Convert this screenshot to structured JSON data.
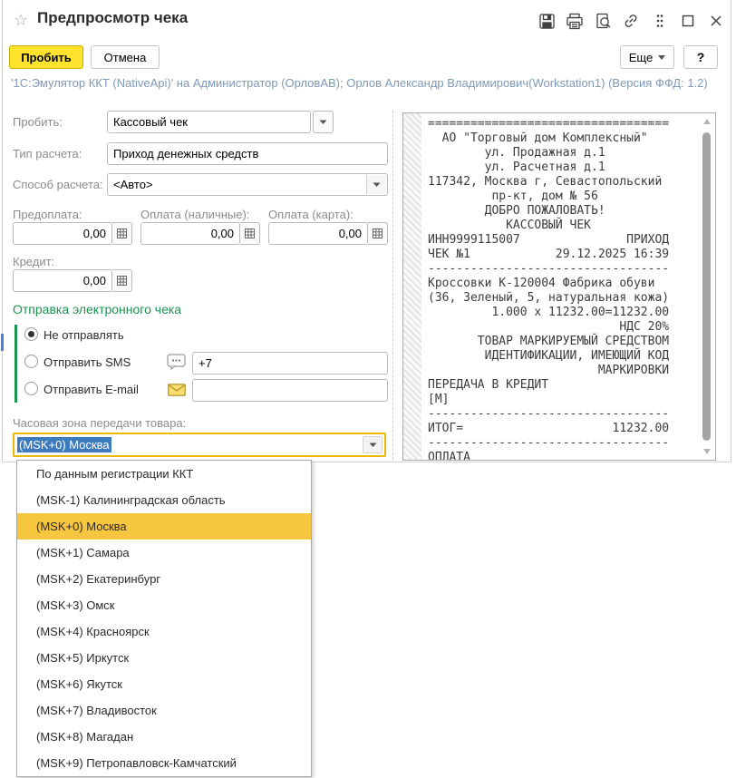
{
  "titlebar": {
    "title": "Предпросмотр чека"
  },
  "toolbar": {
    "commit_label": "Пробить",
    "cancel_label": "Отмена",
    "more_label": "Еще",
    "help_label": "?"
  },
  "device_info": "'1С:Эмулятор ККТ (NativeApi)' на Администратор (ОрловАВ); Орлов Александр Владимирович(Workstation1) (Версия ФФД: 1.2)",
  "form": {
    "probit": {
      "label": "Пробить:",
      "value": "Кассовый чек"
    },
    "payment_type": {
      "label": "Тип расчета:",
      "value": "Приход денежных средств"
    },
    "payment_method": {
      "label": "Способ расчета:",
      "value": "<Авто>"
    },
    "prepayment": {
      "label": "Предоплата:",
      "value": "0,00"
    },
    "cash": {
      "label": "Оплата (наличные):",
      "value": "0,00"
    },
    "card": {
      "label": "Оплата (карта):",
      "value": "0,00"
    },
    "credit": {
      "label": "Кредит:",
      "value": "0,00"
    },
    "electronic_receipt": {
      "title": "Отправка электронного чека",
      "option_none": {
        "label": "Не отправлять",
        "selected": true
      },
      "option_sms": {
        "label": "Отправить SMS",
        "selected": false,
        "value": "+7"
      },
      "option_email": {
        "label": "Отправить E-mail",
        "selected": false,
        "value": ""
      }
    },
    "timezone": {
      "label": "Часовая зона передачи товара:",
      "value": "(MSK+0) Москва"
    }
  },
  "timezone_dropdown": {
    "highlighted_index": 2,
    "items": [
      "По данным регистрации ККТ",
      "(MSK-1) Калининградская область",
      "(MSK+0) Москва",
      "(MSK+1) Самара",
      "(MSK+2) Екатеринбург",
      "(MSK+3) Омск",
      "(MSK+4) Красноярск",
      "(MSK+5) Иркутск",
      "(MSK+6) Якутск",
      "(MSK+7) Владивосток",
      "(MSK+8) Магадан",
      "(MSK+9) Петропавловск-Камчатский"
    ]
  },
  "receipt": {
    "text": "==================================\n  АО \"Торговый дом Комплексный\"\n        ул. Продажная д.1\n        ул. Расчетная д.1\n117342, Москва г, Севастопольский\n         пр-кт, дом № 56\n        ДОБРО ПОЖАЛОВАТЬ!\n           КАССОВЫЙ ЧЕК\nИНН9999115007               ПРИХОД\nЧЕК №1            29.12.2025 16:39\n----------------------------------\nКроссовки К-120004 Фабрика обуви\n(36, Зеленый, 5, натуральная кожа)\n         1.000 x 11232.00=11232.00\n                           НДС 20%\n       ТОВАР МАРКИРУЕМЫЙ СРЕДСТВОМ\n        ИДЕНТИФИКАЦИИ, ИМЕЮЩИЙ КОД\n                        МАРКИРОВКИ\nПЕРЕДАЧА В КРЕДИТ\n[М]\n----------------------------------\nИТОГ=                     11232.00\n----------------------------------\nОПЛАТА"
  },
  "colors": {
    "accent_yellow": "#ffe22b",
    "dropdown_highlight": "#f6c63e",
    "section_green": "#18954e",
    "selection_blue": "#3d7bbf",
    "info_text_blue": "#7e99b8",
    "focus_border": "#edb800"
  },
  "icons": {
    "titlebar": [
      "favorite-star",
      "save",
      "print",
      "print-preview",
      "link",
      "more",
      "maximize",
      "close"
    ],
    "form": [
      "calculator",
      "sms-bubble",
      "email-envelope",
      "chevron-down"
    ]
  }
}
